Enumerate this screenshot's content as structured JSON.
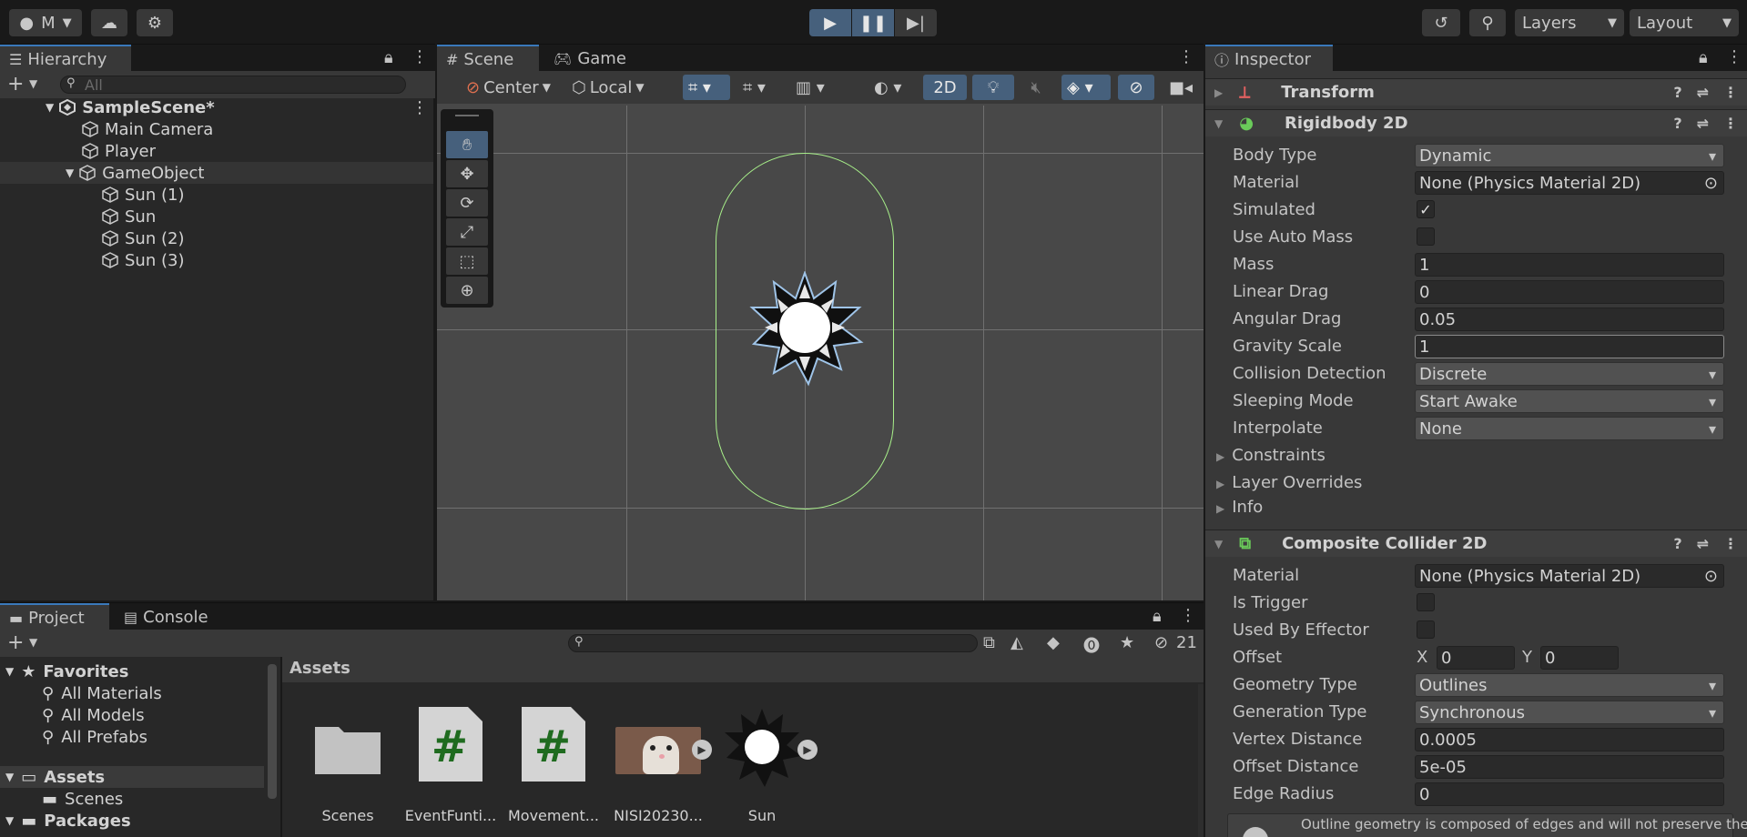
{
  "toolbar": {
    "account_label": "M",
    "layers_label": "Layers",
    "layout_label": "Layout"
  },
  "hierarchy": {
    "tab": "Hierarchy",
    "search_placeholder": "All",
    "scene_name": "SampleScene*",
    "items": [
      "Main Camera",
      "Player",
      "GameObject",
      "Sun (1)",
      "Sun",
      "Sun (2)",
      "Sun (3)"
    ]
  },
  "scene_view": {
    "tab_scene": "Scene",
    "tab_game": "Game",
    "pivot_mode": "Center",
    "pivot_rotation": "Local",
    "mode_2d": "2D"
  },
  "inspector": {
    "tab": "Inspector",
    "transform": "Transform",
    "rigidbody": {
      "title": "Rigidbody 2D",
      "body_type_label": "Body Type",
      "body_type": "Dynamic",
      "material_label": "Material",
      "material": "None (Physics Material 2D)",
      "simulated_label": "Simulated",
      "auto_mass_label": "Use Auto Mass",
      "mass_label": "Mass",
      "mass": "1",
      "linear_drag_label": "Linear Drag",
      "linear_drag": "0",
      "angular_drag_label": "Angular Drag",
      "angular_drag": "0.05",
      "gravity_label": "Gravity Scale",
      "gravity": "1",
      "collision_label": "Collision Detection",
      "collision": "Discrete",
      "sleeping_label": "Sleeping Mode",
      "sleeping": "Start Awake",
      "interpolate_label": "Interpolate",
      "interpolate": "None",
      "constraints": "Constraints",
      "layer_overrides": "Layer Overrides",
      "info": "Info"
    },
    "composite": {
      "title": "Composite Collider 2D",
      "material_label": "Material",
      "material": "None (Physics Material 2D)",
      "trigger_label": "Is Trigger",
      "effector_label": "Used By Effector",
      "offset_label": "Offset",
      "offset_x_label": "X",
      "offset_x": "0",
      "offset_y_label": "Y",
      "offset_y": "0",
      "geometry_label": "Geometry Type",
      "geometry": "Outlines",
      "generation_label": "Generation Type",
      "generation": "Synchronous",
      "vertex_label": "Vertex Distance",
      "vertex": "0.0005",
      "offset_dist_label": "Offset Distance",
      "offset_dist": "5e-05",
      "edge_label": "Edge Radius",
      "edge": "0",
      "help_text": "Outline geometry is composed of edges and will not preserve the"
    }
  },
  "project": {
    "tab_project": "Project",
    "tab_console": "Console",
    "hidden_count": "21",
    "favorites": "Favorites",
    "fav_items": [
      "All Materials",
      "All Models",
      "All Prefabs"
    ],
    "assets": "Assets",
    "scenes": "Scenes",
    "packages": "Packages",
    "breadcrumb": "Assets",
    "asset_items": [
      "Scenes",
      "EventFunti...",
      "Movement...",
      "NISI20230...",
      "Sun"
    ]
  },
  "colors": {
    "accent": "#3a79bb",
    "play_active": "#46607c",
    "collider": "#a8f08a"
  }
}
